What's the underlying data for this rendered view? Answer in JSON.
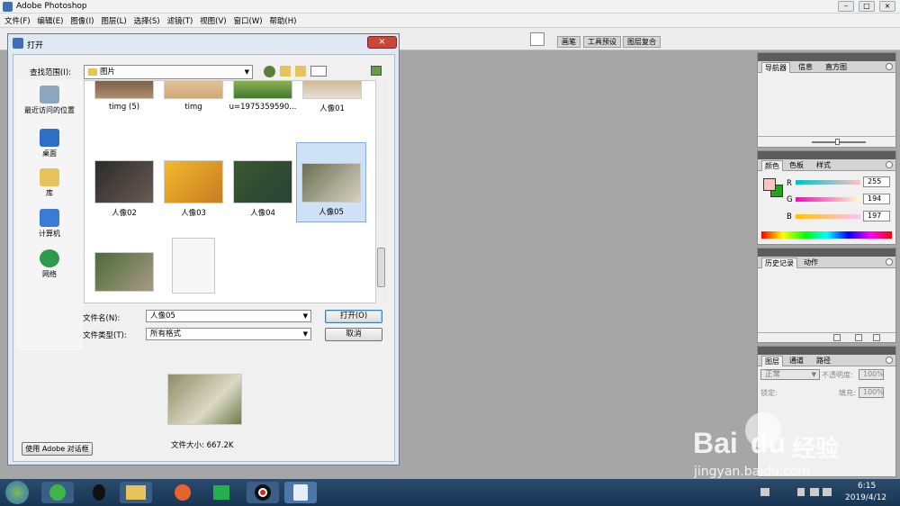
{
  "app": {
    "title": "Adobe Photoshop"
  },
  "window_controls": {
    "minimize": "–",
    "maximize": "□",
    "close": "×"
  },
  "menu": [
    "文件(F)",
    "编辑(E)",
    "图像(I)",
    "图层(L)",
    "选择(S)",
    "滤镜(T)",
    "视图(V)",
    "窗口(W)",
    "帮助(H)"
  ],
  "option_tabs": [
    "画笔",
    "工具预设",
    "图层复合"
  ],
  "dialog": {
    "title": "打开",
    "close": "×",
    "lookin_label": "查找范围(I):",
    "lookin_value": "图片",
    "places": [
      {
        "label": "最近访问的位置",
        "icon": "recent-places-icon"
      },
      {
        "label": "桌面",
        "icon": "desktop-icon"
      },
      {
        "label": "库",
        "icon": "library-icon"
      },
      {
        "label": "计算机",
        "icon": "computer-icon"
      },
      {
        "label": "网络",
        "icon": "network-icon"
      }
    ],
    "files": [
      {
        "name": "timg (5)"
      },
      {
        "name": "timg"
      },
      {
        "name": "u=1975359590..."
      },
      {
        "name": "人像01"
      },
      {
        "name": "人像02"
      },
      {
        "name": "人像03"
      },
      {
        "name": "人像04"
      },
      {
        "name": "人像05"
      },
      {
        "name": ""
      },
      {
        "name": ""
      }
    ],
    "selected_file": "人像05",
    "filename_label": "文件名(N):",
    "filename_value": "人像05",
    "filetype_label": "文件类型(T):",
    "filetype_value": "所有格式",
    "open_button": "打开(O)",
    "cancel_button": "取消",
    "filesize": "文件大小: 667.2K",
    "adobe_dialog_button": "使用 Adobe 对话框"
  },
  "panels": {
    "navigator": {
      "tabs": [
        "导航器",
        "信息",
        "直方图"
      ]
    },
    "color": {
      "tabs": [
        "颜色",
        "色板",
        "样式"
      ],
      "r": "255",
      "g": "194",
      "b": "197",
      "r_label": "R",
      "g_label": "G",
      "b_label": "B",
      "fg_color": "#ffc2c5",
      "bg_color": "#1fa51f"
    },
    "history": {
      "tabs": [
        "历史记录",
        "动作"
      ]
    },
    "layers": {
      "tabs": [
        "图层",
        "通道",
        "路径"
      ],
      "blend_mode": "正常",
      "opacity_label": "不透明度:",
      "opacity": "100%",
      "lock_label": "锁定:",
      "fill_label": "填充:",
      "fill": "100%"
    }
  },
  "taskbar": {
    "time": "6:15",
    "date": "2019/4/12"
  },
  "watermark": {
    "brand": "Bai",
    "brand2": "du",
    "cn": "经验",
    "url": "jingyan.baidu.com"
  }
}
